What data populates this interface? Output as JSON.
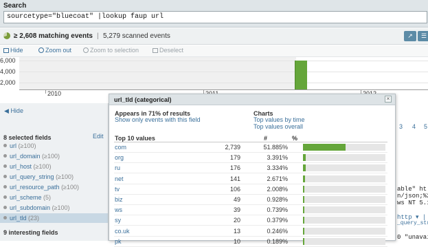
{
  "search": {
    "title": "Search",
    "query": "sourcetype=\"bluecoat\" |lookup faup url"
  },
  "status": {
    "matching": "≥ 2,608 matching events",
    "separator": "|",
    "scanned": "5,279 scanned events"
  },
  "timeline_toolbar": {
    "hide": "Hide",
    "zoom_out": "Zoom out",
    "zoom_to_selection": "Zoom to selection",
    "deselect": "Deselect"
  },
  "timeline": {
    "y_ticks": [
      "6,000",
      "4,000",
      "2,000"
    ],
    "x_ticks": [
      "2010",
      "2011",
      "2012"
    ]
  },
  "fields_panel": {
    "hide": "Hide",
    "selected_header": "8 selected fields",
    "edit": "Edit",
    "selected": [
      {
        "name": "url",
        "count": "(≥100)"
      },
      {
        "name": "url_domain",
        "count": "(≥100)"
      },
      {
        "name": "url_host",
        "count": "(≥100)"
      },
      {
        "name": "url_query_string",
        "count": "(≥100)"
      },
      {
        "name": "url_resource_path",
        "count": "(≥100)"
      },
      {
        "name": "url_scheme",
        "count": "(5)"
      },
      {
        "name": "url_subdomain",
        "count": "(≥100)"
      },
      {
        "name": "url_tld",
        "count": "(23)"
      }
    ],
    "interesting_header": "9 interesting fields"
  },
  "pagination": [
    "3",
    "4",
    "5"
  ],
  "raw_fragments": [
    {
      "text": "able\" ht"
    },
    {
      "text": "n/json;%2"
    },
    {
      "text": "ws NT 5.1;"
    },
    {
      "text": "http ▾ | ur"
    },
    {
      "text": "_query_strin"
    },
    {
      "text": "0 \"unavai"
    }
  ],
  "popup": {
    "title": "url_tld (categorical)",
    "close": "×",
    "appears": "Appears in 71% of results",
    "show_only": "Show only events with this field",
    "charts_header": "Charts",
    "top_by_time": "Top values by time",
    "top_overall": "Top values overall",
    "top10_header": "Top 10 values",
    "col_count": "#",
    "col_pct": "%",
    "values": [
      {
        "name": "com",
        "count": "2,739",
        "pct": "51.885%",
        "frac": 0.51885
      },
      {
        "name": "org",
        "count": "179",
        "pct": "3.391%",
        "frac": 0.03391
      },
      {
        "name": "ru",
        "count": "176",
        "pct": "3.334%",
        "frac": 0.03334
      },
      {
        "name": "net",
        "count": "141",
        "pct": "2.671%",
        "frac": 0.02671
      },
      {
        "name": "tv",
        "count": "106",
        "pct": "2.008%",
        "frac": 0.02008
      },
      {
        "name": "biz",
        "count": "49",
        "pct": "0.928%",
        "frac": 0.00928
      },
      {
        "name": "ws",
        "count": "39",
        "pct": "0.739%",
        "frac": 0.00739
      },
      {
        "name": "sy",
        "count": "20",
        "pct": "0.379%",
        "frac": 0.00379
      },
      {
        "name": "co.uk",
        "count": "13",
        "pct": "0.246%",
        "frac": 0.00246
      },
      {
        "name": "pk",
        "count": "10",
        "pct": "0.189%",
        "frac": 0.00189
      }
    ]
  },
  "colors": {
    "accent_link": "#3a6f9a",
    "bar_green": "#65a63a",
    "header_bg": "#dfe5e8"
  }
}
